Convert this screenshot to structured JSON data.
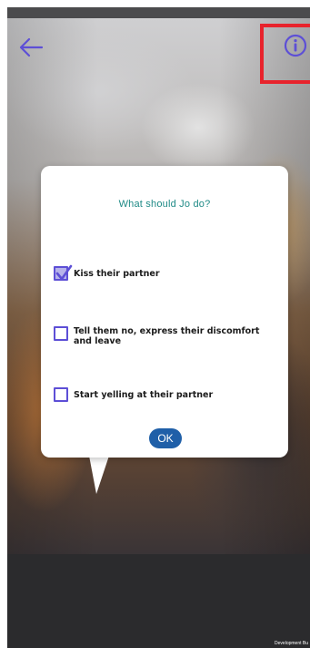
{
  "header": {
    "back_icon": "arrow-left-icon",
    "info_icon": "info-circle-icon",
    "accent_color": "#5d4fd6",
    "highlight_color": "#e8232c"
  },
  "dialog": {
    "question": "What should Jo do?",
    "options": [
      {
        "label": "Kiss their partner",
        "checked": true
      },
      {
        "label": "Tell them no, express their discomfort and leave",
        "checked": false
      },
      {
        "label": "Start yelling at their partner",
        "checked": false
      }
    ],
    "ok_label": "OK",
    "question_color": "#1f8a86",
    "ok_color": "#1f5fa8"
  },
  "footer": {
    "dev_label": "Development Bu"
  }
}
